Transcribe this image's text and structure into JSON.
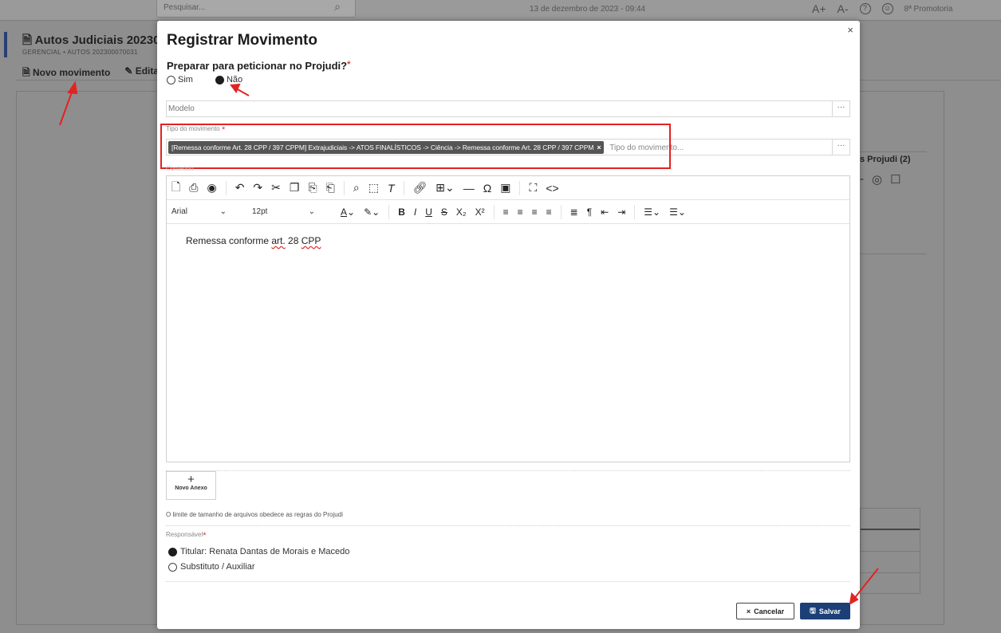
{
  "topbar": {
    "search_placeholder": "Pesquisar...",
    "datetime": "13 de dezembro de 2023 - 09:44",
    "font_increase": "A+",
    "font_decrease": "A-",
    "organization": "8ª Promotoria"
  },
  "background": {
    "page_title": "Autos Judiciais 20230",
    "subtitle": "GERENCIAL • AUTOS 202300070031",
    "actions": [
      "Novo movimento",
      "Editar"
    ],
    "right_tab": "s Projudi (2)"
  },
  "modal": {
    "title": "Registrar Movimento",
    "close_label": "×",
    "prepare_question": "Preparar para peticionar no Projudi?",
    "prepare_options": [
      {
        "label": "Sim",
        "selected": false
      },
      {
        "label": "Não",
        "selected": true
      }
    ],
    "modelo_placeholder": "Modelo",
    "more_label": "···",
    "tipo_label": "Tipo do movimento",
    "tipo_chip": "[Remessa conforme Art. 28 CPP / 397 CPPM] Extrajudiciais -> ATOS FINALÍSTICOS -> Ciência -> Remessa conforme Art. 28 CPP / 397 CPPM",
    "tipo_chip_remove": "×",
    "tipo_placeholder": "Tipo do movimento...",
    "conteudo_label": "Conteúdo",
    "editor": {
      "font": "Arial",
      "size": "12pt",
      "content_before": "Remessa conforme ",
      "content_art": "art.",
      "content_mid": " 28 ",
      "content_cpp": "CPP"
    },
    "attach_label": "Novo Anexo",
    "attach_plus": "+",
    "limit_note": "O limite de tamanho de arquivos obedece as regras do Projudi",
    "responsavel_label": "Responsável",
    "responsavel_options": [
      {
        "label": "Titular: Renata Dantas de Morais e Macedo",
        "selected": true
      },
      {
        "label": "Substituto / Auxiliar",
        "selected": false
      }
    ],
    "cancel_label": "Cancelar",
    "save_label": "Salvar"
  },
  "colors": {
    "accent": "#1c3f77",
    "highlight": "#e32222",
    "required": "#d63b3b"
  }
}
